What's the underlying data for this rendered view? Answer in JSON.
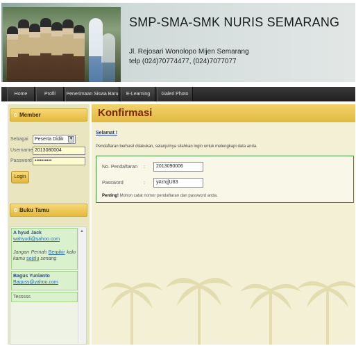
{
  "header": {
    "title": "SMP-SMA-SMK NURIS SEMARANG",
    "address": "Jl. Rejosari Wonolopo Mijen Semarang",
    "phone": "telp (024)70774477, (024)7077077"
  },
  "nav": {
    "items": [
      "Home",
      "Profil",
      "Penerimaan Siswa Baru",
      "E-Learning",
      "Galeri Photo"
    ]
  },
  "member": {
    "heading": "Member",
    "sebagai_label": "Sebagai",
    "sebagai_value": "Peserta Didik",
    "username_label": "Username",
    "username_value": "2013080004",
    "password_label": "Password",
    "password_value": "••••••••••",
    "login_label": "Login"
  },
  "guestbook": {
    "heading": "Buku Tamu",
    "entries": [
      {
        "name": "A hyud Jack",
        "email": "wahyudi@yahoo.com",
        "msg_pre": "Jangan Pernah",
        "msg_link1": "Berpikir",
        "msg_mid": "kalo kamu",
        "msg_link2": "sejelu",
        "msg_post": "senang"
      },
      {
        "name": "Bagus Yunianto",
        "email": "Bagusy@yahoo.com"
      },
      {
        "name": "Tesssss"
      }
    ]
  },
  "main": {
    "title": "Konfirmasi",
    "greeting": "Selamat !",
    "description": "Pendaftaran berhasil dilakukan, selanjutnya silahkan login untuk melengkapi data anda.",
    "fields": [
      {
        "label": "No. Pendaftaran",
        "value": "2013090006"
      },
      {
        "label": "Password",
        "value": "y#z!q]U83"
      }
    ],
    "colon": ":",
    "note_bold": "Penting!",
    "note_text": "Mohon catat nomor pendaftaran dan password anda."
  },
  "colors": {
    "accent": "#e6b93a",
    "nav": "#2a2a2a",
    "border_green": "#3d8c3d",
    "title": "#7a2600"
  },
  "icons": [
    "dropdown-arrow-icon",
    "scroll-up-icon"
  ]
}
